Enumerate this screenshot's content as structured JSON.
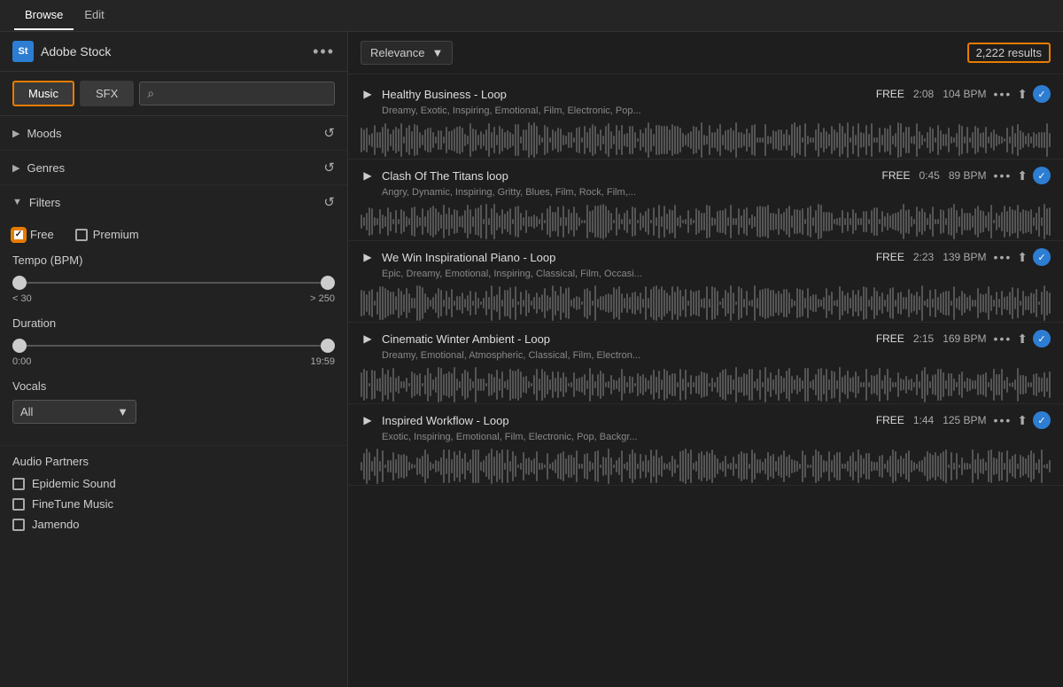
{
  "topTabs": {
    "tabs": [
      {
        "label": "Browse",
        "active": true
      },
      {
        "label": "Edit",
        "active": false
      }
    ]
  },
  "panelHeader": {
    "badgeText": "St",
    "title": "Adobe Stock",
    "moreIcon": "•••"
  },
  "searchBar": {
    "musicLabel": "Music",
    "sfxLabel": "SFX",
    "searchPlaceholder": ""
  },
  "filters": {
    "moods": {
      "label": "Moods"
    },
    "genres": {
      "label": "Genres"
    },
    "filtersSection": {
      "label": "Filters",
      "freeLabel": "Free",
      "premiumLabel": "Premium",
      "tempoLabel": "Tempo (BPM)",
      "tempoMin": "< 30",
      "tempoMax": "> 250",
      "durationLabel": "Duration",
      "durationMin": "0:00",
      "durationMax": "19:59",
      "vocalsLabel": "Vocals",
      "vocalsValue": "All"
    },
    "audioPartners": {
      "label": "Audio Partners",
      "partners": [
        {
          "name": "Epidemic Sound"
        },
        {
          "name": "FineTune Music"
        },
        {
          "name": "Jamendo"
        }
      ]
    }
  },
  "resultsHeader": {
    "sortLabel": "Relevance",
    "resultsCount": "2,222 results"
  },
  "tracks": [
    {
      "name": "Healthy Business - Loop",
      "free": "FREE",
      "duration": "2:08",
      "bpm": "104 BPM",
      "tags": "Dreamy, Exotic, Inspiring, Emotional, Film, Electronic, Pop..."
    },
    {
      "name": "Clash Of The Titans loop",
      "free": "FREE",
      "duration": "0:45",
      "bpm": "89 BPM",
      "tags": "Angry, Dynamic, Inspiring, Gritty, Blues, Film, Rock, Film,..."
    },
    {
      "name": "We Win Inspirational Piano - Loop",
      "free": "FREE",
      "duration": "2:23",
      "bpm": "139 BPM",
      "tags": "Epic, Dreamy, Emotional, Inspiring, Classical, Film, Occasi..."
    },
    {
      "name": "Cinematic Winter Ambient - Loop",
      "free": "FREE",
      "duration": "2:15",
      "bpm": "169 BPM",
      "tags": "Dreamy, Emotional, Atmospheric, Classical, Film, Electron..."
    },
    {
      "name": "Inspired Workflow - Loop",
      "free": "FREE",
      "duration": "1:44",
      "bpm": "125 BPM",
      "tags": "Exotic, Inspiring, Emotional, Film, Electronic, Pop, Backgr..."
    }
  ]
}
